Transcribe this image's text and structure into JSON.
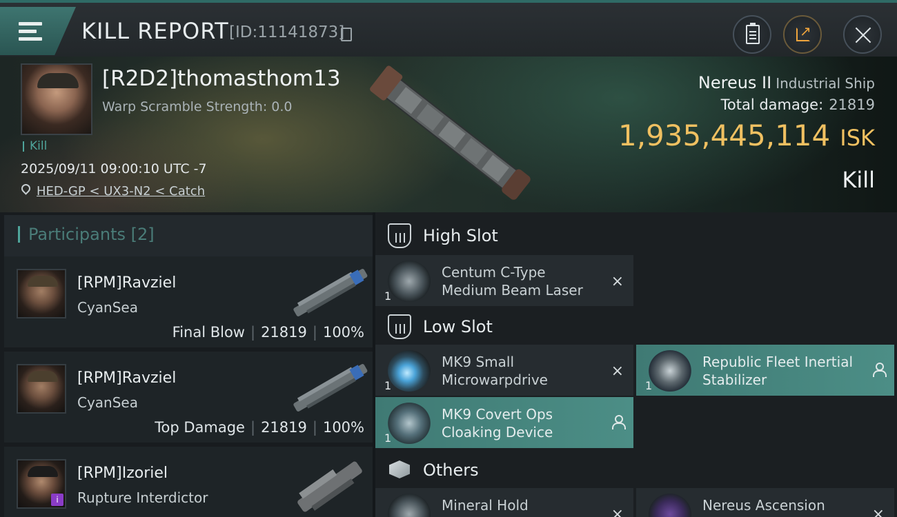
{
  "header": {
    "title": "KILL REPORT",
    "report_id": "[ID:11141873]"
  },
  "victim": {
    "name": "[R2D2]thomasthom13",
    "warp_scramble": "Warp Scramble Strength: 0.0",
    "kill_tag": "Kill",
    "datetime": "2025/09/11 09:00:10 UTC -7",
    "location": "HED-GP < UX3-N2 < Catch",
    "ship_name": "Nereus II",
    "ship_class": "Industrial Ship",
    "total_damage_label": "Total damage:",
    "total_damage": "21819",
    "isk_value": "1,935,445,114",
    "isk_unit": "ISK",
    "result": "Kill"
  },
  "participants": {
    "label": "Participants",
    "count": "[2]",
    "rows": [
      {
        "name": "[RPM]Ravziel",
        "corp": "CyanSea",
        "role": "Final Blow",
        "damage": "21819",
        "percent": "100%"
      },
      {
        "name": "[RPM]Ravziel",
        "corp": "CyanSea",
        "role": "Top Damage",
        "damage": "21819",
        "percent": "100%"
      },
      {
        "name": "[RPM]Izoriel",
        "corp": "Rupture Interdictor",
        "badge": "i"
      }
    ]
  },
  "modules": {
    "high_slot": {
      "label": "High Slot",
      "items": [
        {
          "name_line1": "Centum C-Type",
          "name_line2": "Medium Beam Laser",
          "qty": "1",
          "status": "destroyed"
        }
      ]
    },
    "low_slot": {
      "label": "Low Slot",
      "items": [
        {
          "name_line1": "MK9 Small",
          "name_line2": "Microwarpdrive",
          "qty": "1",
          "status": "destroyed"
        },
        {
          "name_line1": "Republic Fleet Inertial",
          "name_line2": "Stabilizer",
          "qty": "1",
          "status": "dropped"
        },
        {
          "name_line1": "MK9 Covert Ops",
          "name_line2": "Cloaking Device",
          "qty": "1",
          "status": "dropped"
        }
      ]
    },
    "others": {
      "label": "Others",
      "items": [
        {
          "name_line1": "Mineral Hold",
          "status": "destroyed"
        },
        {
          "name_line1": "Nereus Ascension",
          "status": "destroyed"
        }
      ]
    }
  },
  "icons": {
    "destroyed": "×"
  },
  "colors": {
    "accent": "#4fa59b",
    "isk": "#f0c061",
    "fitted_bg": "#4c8e86"
  }
}
